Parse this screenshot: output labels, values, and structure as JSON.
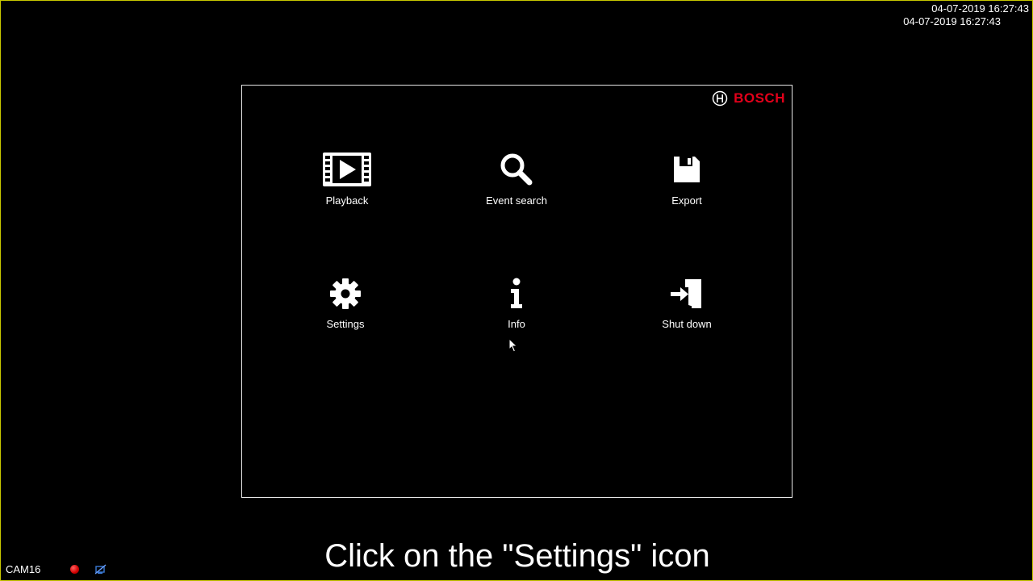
{
  "screen": {
    "timestamp_primary": "04-07-2019 16:27:43",
    "timestamp_secondary": "04-07-2019 16:27:43",
    "border_color": "#c8c800"
  },
  "brand": {
    "name": "BOSCH",
    "color": "#e2001a",
    "icon": "bosch-armature-icon"
  },
  "menu": {
    "items": [
      {
        "label": "Playback",
        "icon": "film-play-icon"
      },
      {
        "label": "Event search",
        "icon": "search-icon"
      },
      {
        "label": "Export",
        "icon": "floppy-disk-icon"
      },
      {
        "label": "Settings",
        "icon": "gear-icon"
      },
      {
        "label": "Info",
        "icon": "info-icon"
      },
      {
        "label": "Shut down",
        "icon": "logout-door-icon"
      }
    ]
  },
  "caption": "Click on the \"Settings\" icon",
  "status_bar": {
    "camera": "CAM16",
    "record_color": "#d00000",
    "network_icon": "network-disconnected-icon"
  }
}
